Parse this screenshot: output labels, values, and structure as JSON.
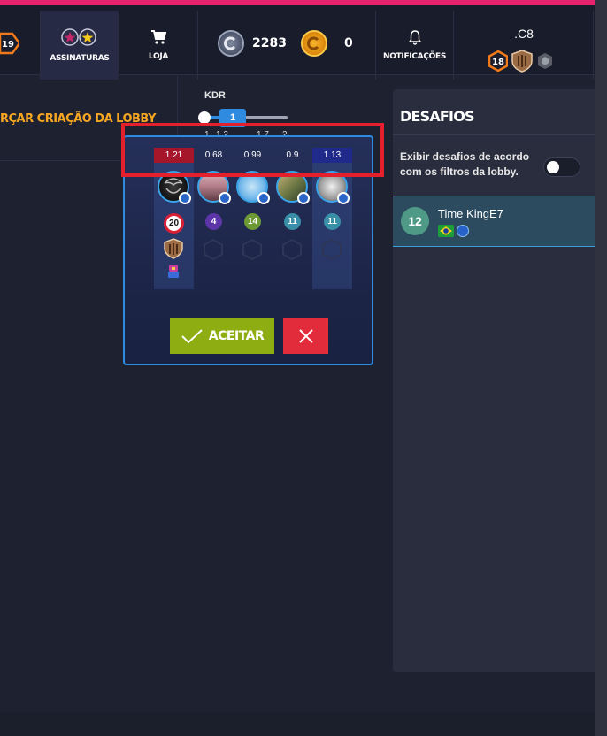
{
  "topbar": {
    "player_level": "19",
    "nav": {
      "subscriptions_label": "ASSINATURAS",
      "store_label": "LOJA",
      "notifications_label": "NOTIFICAÇÕES"
    },
    "currency": {
      "silver_amount": "2283",
      "gold_amount": "0"
    },
    "profile": {
      "name": ".C8",
      "level": "18"
    },
    "accent_color": "#e8236d"
  },
  "lobby": {
    "force_create_label": "RÇAR CRIAÇÃO DA LOBBY",
    "kdr": {
      "label": "KDR",
      "value": "1",
      "ticks": [
        "1",
        "1.2",
        "1.7",
        "2"
      ]
    }
  },
  "challenge": {
    "players": [
      {
        "kdr": "1.21",
        "level": "20",
        "kdr_color": "red"
      },
      {
        "kdr": "0.68",
        "level": "4",
        "kdr_color": "none"
      },
      {
        "kdr": "0.99",
        "level": "14",
        "kdr_color": "none"
      },
      {
        "kdr": "0.9",
        "level": "11",
        "kdr_color": "none"
      },
      {
        "kdr": "1.13",
        "level": "11",
        "kdr_color": "blue"
      }
    ],
    "accept_label": "ACEITAR",
    "accept_color": "#8dad12",
    "reject_color": "#e32c3b"
  },
  "challenges_panel": {
    "title": "DESAFIOS",
    "filter_text": "Exibir desafios de acordo com os filtros da lobby.",
    "filter_toggle_on": false,
    "team": {
      "level": "12",
      "name": "Time KingE7"
    }
  }
}
